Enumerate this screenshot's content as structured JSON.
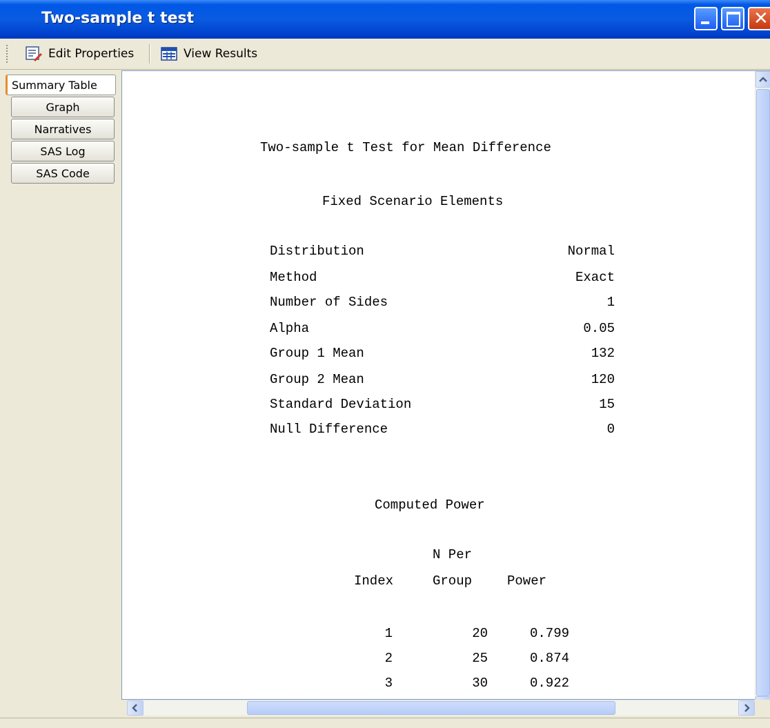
{
  "window": {
    "title": "Two-sample t test"
  },
  "toolbar": {
    "edit_label": "Edit Properties",
    "view_label": "View Results"
  },
  "tabs": [
    {
      "label": "Summary Table",
      "active": true
    },
    {
      "label": "Graph"
    },
    {
      "label": "Narratives"
    },
    {
      "label": "SAS Log"
    },
    {
      "label": "SAS Code"
    }
  ],
  "report": {
    "title": "Two-sample t Test for Mean Difference",
    "fixed_heading": "Fixed Scenario Elements",
    "fixed": [
      {
        "label": "Distribution",
        "value": "Normal"
      },
      {
        "label": "Method",
        "value": "Exact"
      },
      {
        "label": "Number of Sides",
        "value": "1"
      },
      {
        "label": "Alpha",
        "value": "0.05"
      },
      {
        "label": "Group 1 Mean",
        "value": "132"
      },
      {
        "label": "Group 2 Mean",
        "value": "120"
      },
      {
        "label": "Standard Deviation",
        "value": "15"
      },
      {
        "label": "Null Difference",
        "value": "0"
      }
    ],
    "power_heading": "Computed Power",
    "columns": {
      "index": "Index",
      "n_top": "N Per",
      "n_bottom": "Group",
      "power": "Power"
    },
    "rows": [
      {
        "index": "1",
        "n": "20",
        "power": "0.799"
      },
      {
        "index": "2",
        "n": "25",
        "power": "0.874"
      },
      {
        "index": "3",
        "n": "30",
        "power": "0.922"
      }
    ]
  }
}
